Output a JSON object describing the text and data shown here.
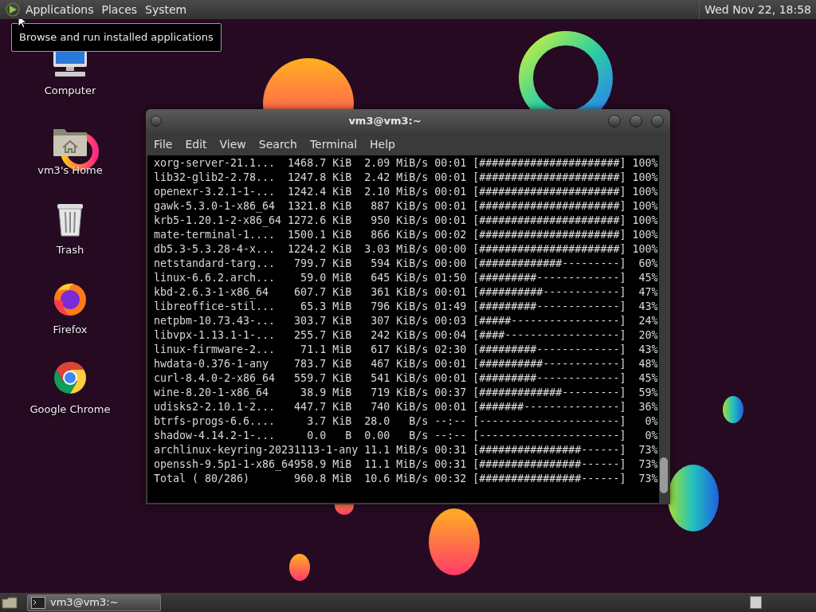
{
  "top_panel": {
    "menus": [
      "Applications",
      "Places",
      "System"
    ],
    "clock": "Wed Nov 22, 18:58"
  },
  "tooltip": "Browse and run installed applications",
  "desktop_icons": [
    {
      "label": "Computer",
      "kind": "computer"
    },
    {
      "label": "vm3's Home",
      "kind": "home"
    },
    {
      "label": "Trash",
      "kind": "trash"
    },
    {
      "label": "Firefox",
      "kind": "firefox"
    },
    {
      "label": "Google Chrome",
      "kind": "chrome"
    }
  ],
  "terminal": {
    "title": "vm3@vm3:~",
    "menu": [
      "File",
      "Edit",
      "View",
      "Search",
      "Terminal",
      "Help"
    ],
    "lines": [
      "xorg-server-21.1...  1468.7 KiB  2.09 MiB/s 00:01 [######################] 100%",
      "lib32-glib2-2.78...  1247.8 KiB  2.42 MiB/s 00:01 [######################] 100%",
      "openexr-3.2.1-1-...  1242.4 KiB  2.10 MiB/s 00:01 [######################] 100%",
      "gawk-5.3.0-1-x86_64  1321.8 KiB   887 KiB/s 00:01 [######################] 100%",
      "krb5-1.20.1-2-x86_64 1272.6 KiB   950 KiB/s 00:01 [######################] 100%",
      "mate-terminal-1....  1500.1 KiB   866 KiB/s 00:02 [######################] 100%",
      "db5.3-5.3.28-4-x...  1224.2 KiB  3.03 MiB/s 00:00 [######################] 100%",
      "netstandard-targ...   799.7 KiB   594 KiB/s 00:00 [#############---------]  60%",
      "linux-6.6.2.arch...    59.0 MiB   645 KiB/s 01:50 [#########-------------]  45%",
      "kbd-2.6.3-1-x86_64    607.7 KiB   361 KiB/s 00:01 [##########------------]  47%",
      "libreoffice-stil...    65.3 MiB   796 KiB/s 01:49 [#########-------------]  43%",
      "netpbm-10.73.43-...   303.7 KiB   307 KiB/s 00:03 [#####-----------------]  24%",
      "libvpx-1.13.1-1-...   255.7 KiB   242 KiB/s 00:04 [####------------------]  20%",
      "linux-firmware-2...    71.1 MiB   617 KiB/s 02:30 [#########-------------]  43%",
      "hwdata-0.376-1-any    783.7 KiB   467 KiB/s 00:01 [##########------------]  48%",
      "curl-8.4.0-2-x86_64   559.7 KiB   541 KiB/s 00:01 [#########-------------]  45%",
      "wine-8.20-1-x86_64     38.9 MiB   719 KiB/s 00:37 [#############---------]  59%",
      "udisks2-2.10.1-2...   447.7 KiB   740 KiB/s 00:01 [#######---------------]  36%",
      "btrfs-progs-6.6....     3.7 KiB  28.0   B/s --:-- [----------------------]   0%",
      "shadow-4.14.2-1-...     0.0   B  0.00   B/s --:-- [----------------------]   0%",
      "archlinux-keyring-20231113-1-any 11.1 MiB/s 00:31 [################------]  73%",
      "openssh-9.5p1-1-x86_64958.9 MiB  11.1 MiB/s 00:31 [################------]  73%",
      "Total ( 80/286)       960.8 MiB  10.6 MiB/s 00:32 [################------]  73%"
    ]
  },
  "taskbar": {
    "tasks": [
      {
        "label": "vm3@vm3:~",
        "selected": true
      }
    ]
  }
}
